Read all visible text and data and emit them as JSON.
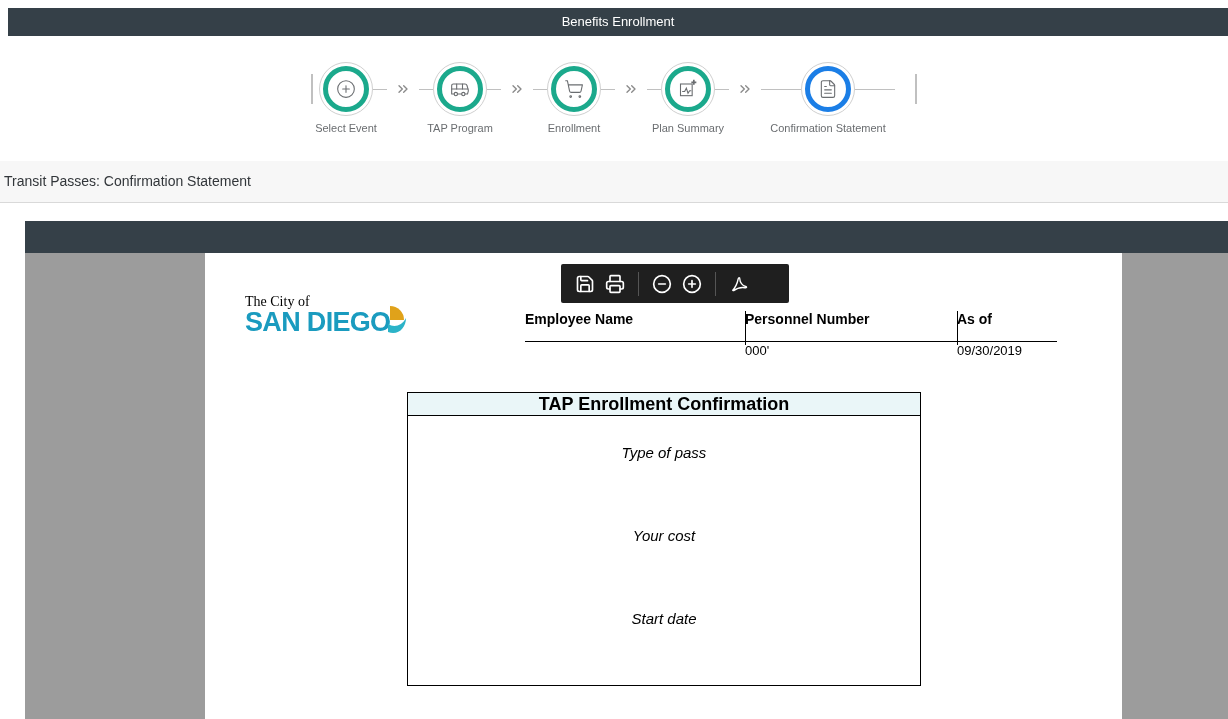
{
  "header": {
    "title": "Benefits Enrollment"
  },
  "steps": [
    {
      "label": "Select Event",
      "kind": "add",
      "selected": false
    },
    {
      "label": "TAP Program",
      "kind": "bus",
      "selected": false
    },
    {
      "label": "Enrollment",
      "kind": "cart",
      "selected": false
    },
    {
      "label": "Plan Summary",
      "kind": "chart",
      "selected": false
    },
    {
      "label": "Confirmation Statement",
      "kind": "pdf",
      "selected": true
    }
  ],
  "page_title": "Transit Passes: Confirmation Statement",
  "document": {
    "logo": {
      "line_1": "The City of",
      "line_2": "SAN DIEGO"
    },
    "columns": [
      {
        "label": "Employee Name"
      },
      {
        "label": "Personnel Number",
        "value": "000'"
      },
      {
        "label": "As of",
        "value": "09/30/2019"
      }
    ],
    "box": {
      "title": "TAP Enrollment Confirmation",
      "fields": [
        "Type of pass",
        "Your cost",
        "Start date"
      ]
    }
  }
}
